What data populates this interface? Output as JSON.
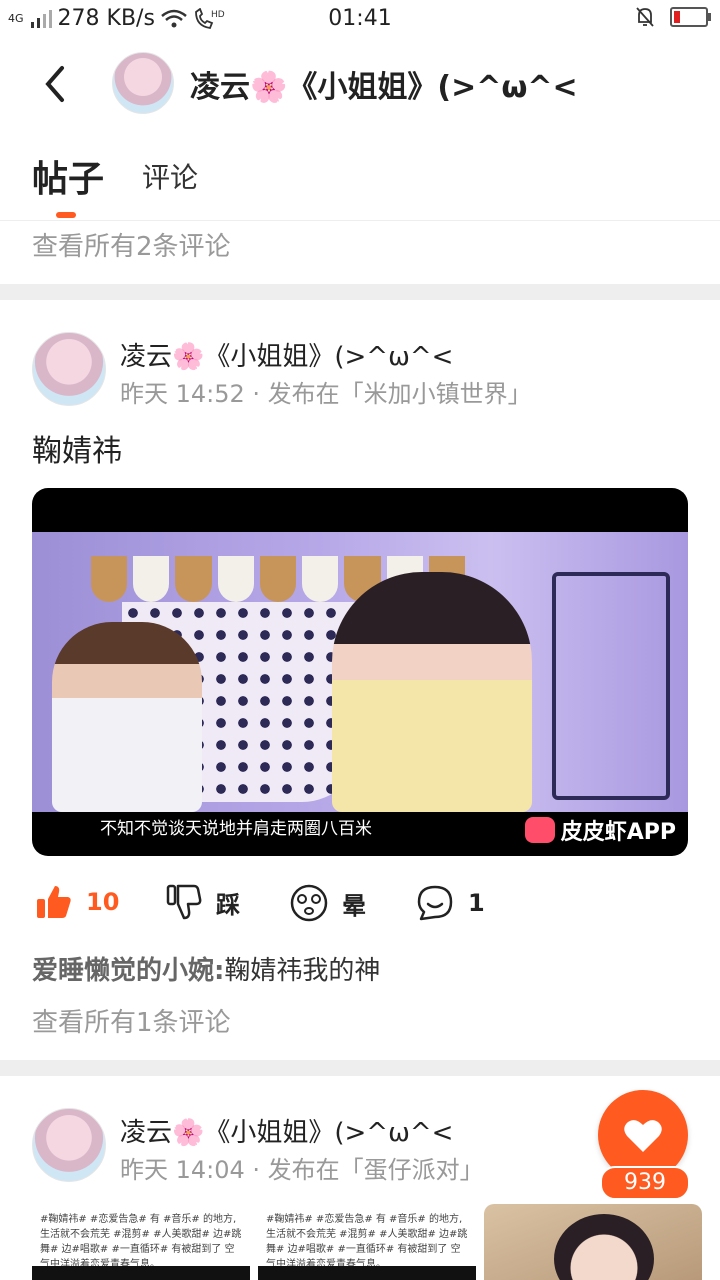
{
  "status_bar": {
    "network": "4G",
    "speed": "278 KB/s",
    "time": "01:41"
  },
  "header": {
    "title": "凌云🌸《小姐姐》(>^ω^<"
  },
  "tabs": [
    {
      "label": "帖子",
      "active": true
    },
    {
      "label": "评论",
      "active": false
    }
  ],
  "prev_post": {
    "view_all_comments": "查看所有2条评论"
  },
  "post1": {
    "author": "凌云🌸《小姐姐》(>^ω^<",
    "meta": "昨天 14:52 · 发布在「米加小镇世界」",
    "text": "鞠婧祎",
    "video": {
      "subtitle": "不知不觉谈天说地并肩走两圈八百米",
      "watermark": "皮皮虾APP"
    },
    "actions": {
      "like_count": "10",
      "dislike_label": "踩",
      "dizzy_label": "晕",
      "comment_count": "1"
    },
    "comment": {
      "user": "爱睡懒觉的小婉:",
      "text": "鞠婧祎我的神"
    },
    "view_all_comments": "查看所有1条评论"
  },
  "post2": {
    "author": "凌云🌸《小姐姐》(>^ω^<",
    "meta": "昨天 14:04 · 发布在「蛋仔派对」",
    "thumb_text_1": "#鞠婧祎# #恋爱告急# 有 #音乐# 的地方, 生活就不会荒芜 #混剪# #人美歌甜# 边#跳舞# 边#唱歌# #一直循环# 有被甜到了 空气中洋溢着恋爱青春气息。",
    "thumb_text_2": "#鞠婧祎# #恋爱告急# 有 #音乐# 的地方, 生活就不会荒芜 #混剪# #人美歌甜# 边#跳舞# 边#唱歌# #一直循环# 有被甜到了 空气中洋溢着恋爱青春气息。"
  },
  "fab": {
    "count": "939"
  },
  "colors": {
    "accent": "#ff5a1f",
    "separator": "#eeeeee",
    "meta_text": "#999999"
  }
}
